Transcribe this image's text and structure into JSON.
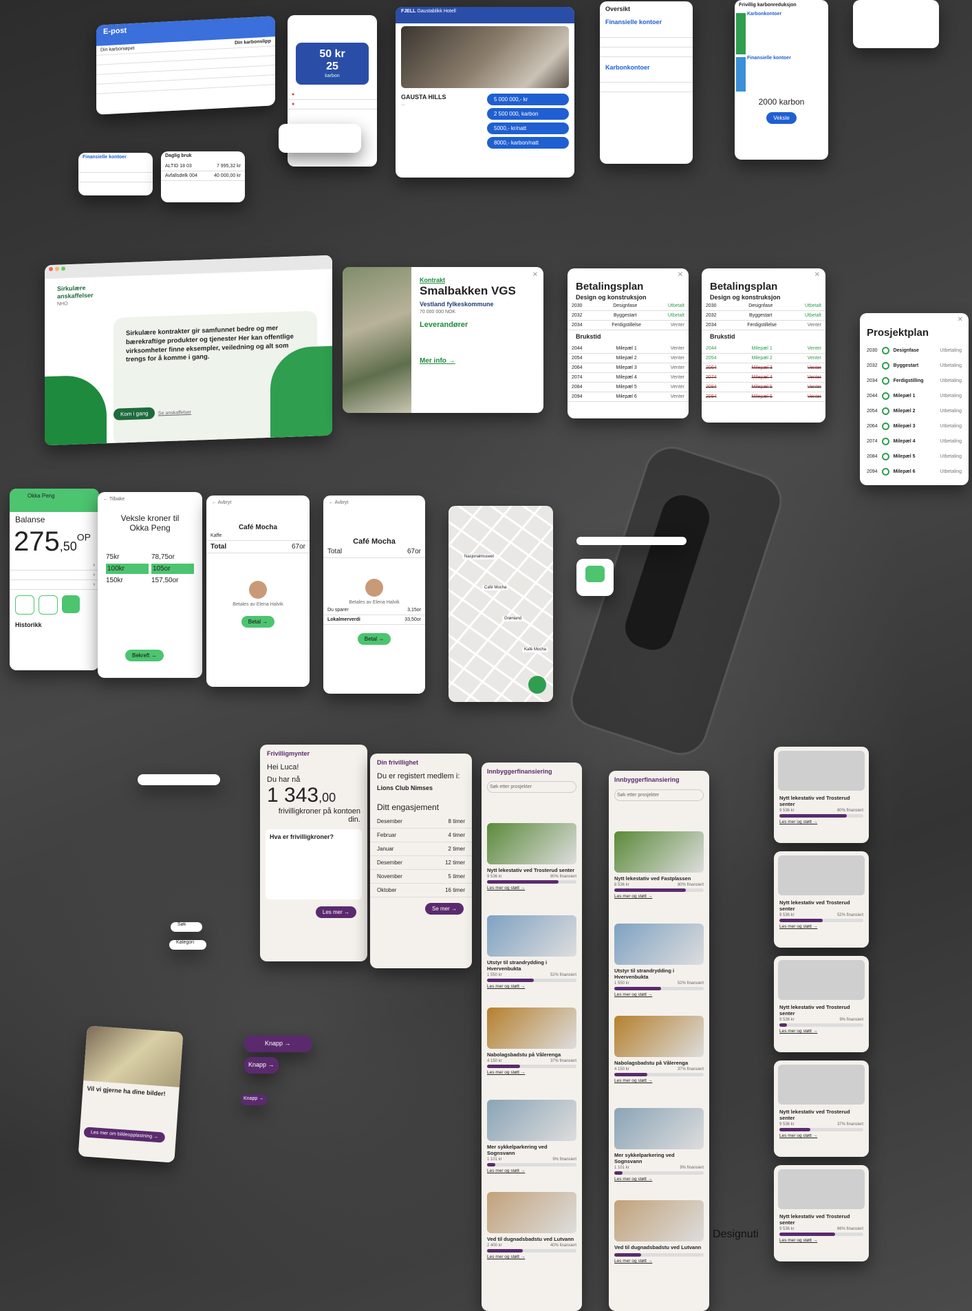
{
  "email": {
    "title": "E-post",
    "line1_left": "Din karboniøpet",
    "line1_right": "Din karbonslipp"
  },
  "phone_top": {
    "amount1": "50 kr",
    "amount2": "25",
    "unit": "karbon"
  },
  "gausta": {
    "label": "FJELL",
    "subtitle": "Gaustablikk Hotell",
    "place": "GAUSTA HILLS",
    "price1": "5 000 000,- kr",
    "price2": "2 500 000, karbon",
    "btn1": "5000,- kr/natt",
    "btn2": "8000,- karbon/natt"
  },
  "oversikt": {
    "title": "Oversikt",
    "sub1": "Finansielle kontoer",
    "sub2": "Karbonkontoer"
  },
  "frivillig": {
    "title": "Frivillig karbonreduksjon",
    "sub1": "Karbonkontoer",
    "sub2": "Finansielle kontoer",
    "amount": "2000 karbon",
    "btn": "Veksle"
  },
  "fin_small": {
    "title": "Finansielle kontoer"
  },
  "daglig": {
    "title": "Daglig bruk",
    "item1": "ALTID 18 03",
    "item2": "Avfallsdelk 004",
    "val1": "7 995,32 kr",
    "val2": "40 000,00 kr"
  },
  "sirk": {
    "brand": "Sirkulære anskaffelser",
    "logos": "NHO",
    "headline": "Sirkulære kontrakter gir samfunnet bedre og mer bærekraftige produkter og tjenester Her kan offentlige virksomheter finne eksempler, veiledning og alt som trengs for å komme i gang.",
    "btn": "Kom i gang",
    "link": "Se anskaffelser"
  },
  "kontrakt": {
    "label": "Kontrakt",
    "title": "Smalbakken VGS",
    "owner": "Vestland fylkeskommune",
    "cost": "70 000 000 NOK",
    "lev": "Leverandører",
    "more": "Mer info →"
  },
  "bp1": {
    "title": "Betalingsplan",
    "sub": "Design og konstruksjon",
    "sub2": "Brukstid"
  },
  "bp2": {
    "title": "Betalingsplan",
    "sub": "Design og konstruksjon",
    "sub2": "Brukstid"
  },
  "plan_rows": [
    {
      "y": "2030",
      "n": "Designfase",
      "s": "Utbetalt"
    },
    {
      "y": "2032",
      "n": "Byggestart",
      "s": "Utbetalt"
    },
    {
      "y": "2034",
      "n": "Ferdigstillelse",
      "s": "Venter"
    }
  ],
  "milestones": [
    {
      "y": "2044",
      "n": "Milepæl 1",
      "s": "Venter"
    },
    {
      "y": "2054",
      "n": "Milepæl 2",
      "s": "Venter"
    },
    {
      "y": "2064",
      "n": "Milepæl 3",
      "s": "Venter"
    },
    {
      "y": "2074",
      "n": "Milepæl 4",
      "s": "Venter"
    },
    {
      "y": "2084",
      "n": "Milepæl 5",
      "s": "Venter"
    },
    {
      "y": "2094",
      "n": "Milepæl 6",
      "s": "Venter"
    }
  ],
  "prosjekt": {
    "title": "Prosjektplan",
    "rows": [
      {
        "y": "2030",
        "n": "Designfase",
        "s": "Utbetaling"
      },
      {
        "y": "2032",
        "n": "Byggestart",
        "s": "Utbetaling"
      },
      {
        "y": "2034",
        "n": "Ferdigstilling",
        "s": "Utbetaling"
      },
      {
        "y": "2044",
        "n": "Milepæl 1",
        "s": "Utbetaling"
      },
      {
        "y": "2054",
        "n": "Milepæl 2",
        "s": "Utbetaling"
      },
      {
        "y": "2064",
        "n": "Milepæl 3",
        "s": "Utbetaling"
      },
      {
        "y": "2074",
        "n": "Milepæl 4",
        "s": "Utbetaling"
      },
      {
        "y": "2084",
        "n": "Milepæl 5",
        "s": "Utbetaling"
      },
      {
        "y": "2094",
        "n": "Milepæl 6",
        "s": "Utbetaling"
      }
    ]
  },
  "okka": {
    "brand": "Okka Peng",
    "balance_label": "Balanse",
    "balance": "275",
    "dec": ",50",
    "unit": "OP",
    "hist": "Historikk"
  },
  "veksle": {
    "back": "← Tilbake",
    "title": "Veksle kroner til Okka Peng",
    "v1": "75kr",
    "v2": "78,75or",
    "v3": "100kr",
    "v4": "105or",
    "v5": "150kr",
    "v6": "157,50or",
    "btn": "Bekreft →"
  },
  "cafe1": {
    "back": "← Avbryt",
    "title": "Café Mocha",
    "kaffe": "Kaffe",
    "total": "Total",
    "amount": "67or",
    "by": "Betales av Elena Halvik",
    "btn": "Betal →"
  },
  "cafe2": {
    "back": "← Avbryt",
    "title": "Café Mocha",
    "total": "Total",
    "amount": "67or",
    "by": "Betales av Elena Halvik",
    "spar": "Du sparer",
    "spar_v": "3,15or",
    "lok": "Lokalmerverdi",
    "lok_v": "33,50or",
    "btn": "Betal →"
  },
  "map": {
    "labels": [
      "Nasjonalmuseet",
      "Café Mocha",
      "Grønland",
      "Kafé Mocha"
    ]
  },
  "friv": {
    "header": "Frivilligmynter",
    "hei": "Hei Luca!",
    "du": "Du har nå",
    "amount": "1 343",
    "dec": ",00",
    "unit": "frivilligkroner på kontoen din.",
    "q": "Hva er frivilligkroner?",
    "btn": "Les mer →"
  },
  "dinf": {
    "header": "Din frivillighet",
    "reg": "Du er registert medlem i:",
    "club": "Lions Club Nimses",
    "eng": "Ditt engasjement",
    "rows": [
      {
        "m": "Desember",
        "h": "8 timer"
      },
      {
        "m": "Februar",
        "h": "4 timer"
      },
      {
        "m": "Januar",
        "h": "2 timer"
      },
      {
        "m": "Desember",
        "h": "12 timer"
      },
      {
        "m": "November",
        "h": "5 timer"
      },
      {
        "m": "Oktober",
        "h": "16 timer"
      }
    ],
    "btn": "Se mer →"
  },
  "innb1": {
    "header": "Innbyggerfinansiering",
    "search": "Søk etter prosjekter",
    "items": [
      {
        "t": "Nytt lekestativ ved Trosterud senter",
        "v": "9 536 kr",
        "p": "80% finansiert",
        "f": 0.8
      },
      {
        "t": "Utstyr til strandrydding i Hvervenbukta",
        "v": "1 550 kr",
        "p": "52% finansiert",
        "f": 0.52
      },
      {
        "t": "Nabolagsbadstu på Vålerenga",
        "v": "4 150 kr",
        "p": "37% finansiert",
        "f": 0.37
      },
      {
        "t": "Mer sykkelparkering ved Sognsvann",
        "v": "1 101 kr",
        "p": "9% finansiert",
        "f": 0.09
      },
      {
        "t": "Ved til dugnadsbadstu ved Lutvann",
        "v": "2 400 kr",
        "p": "40% finansiert",
        "f": 0.4
      }
    ],
    "link": "Les mer og støtt →"
  },
  "innb2": {
    "header": "Innbyggerfinansiering",
    "search": "Søk etter prosjekter",
    "items": [
      {
        "t": "Nytt lekestativ ved Fastplassen",
        "v": "8 536 kr",
        "p": "80% finansiert",
        "f": 0.8
      },
      {
        "t": "Utstyr til strandrydding i Hvervenbukta",
        "v": "1 550 kr",
        "p": "52% finansiert",
        "f": 0.52
      },
      {
        "t": "Nabolagsbadstu på Vålerenga",
        "v": "4 150 kr",
        "p": "37% finansiert",
        "f": 0.37
      },
      {
        "t": "Mer sykkelparkering ved Sognsvann",
        "v": "1 101 kr",
        "p": "9% finansiert",
        "f": 0.09
      },
      {
        "t": "Ved til dugnadsbadstu ved Lutvann",
        "v": "",
        "p": "",
        "f": 0.3
      }
    ],
    "link": "Les mer og støtt →"
  },
  "skel": {
    "title": "Nytt lekestativ ved Trosterud senter",
    "v": "9 536 kr",
    "link": "Les mer og støtt →",
    "pcts": [
      "80% finansiert",
      "52% finansiert",
      "9% finansiert",
      "37% finansiert",
      "66% finansiert"
    ],
    "fills": [
      0.8,
      0.52,
      0.09,
      0.37,
      0.66
    ]
  },
  "bilde": {
    "title": "Vil vi gjerne ha dine bilder!",
    "btn": "Les mer om bildeopplastning →"
  },
  "knapp": {
    "k1": "Knapp →",
    "k2": "Knapp →",
    "k3": "Knapp →"
  },
  "chips": {
    "c1": "Søk",
    "c2": "Kategori"
  },
  "watermark": "Designuti",
  "colors": {
    "blue": "#1f5fd1",
    "green": "#2f9e4f",
    "purple": "#5b2a6e",
    "red": "#d43b3b"
  }
}
